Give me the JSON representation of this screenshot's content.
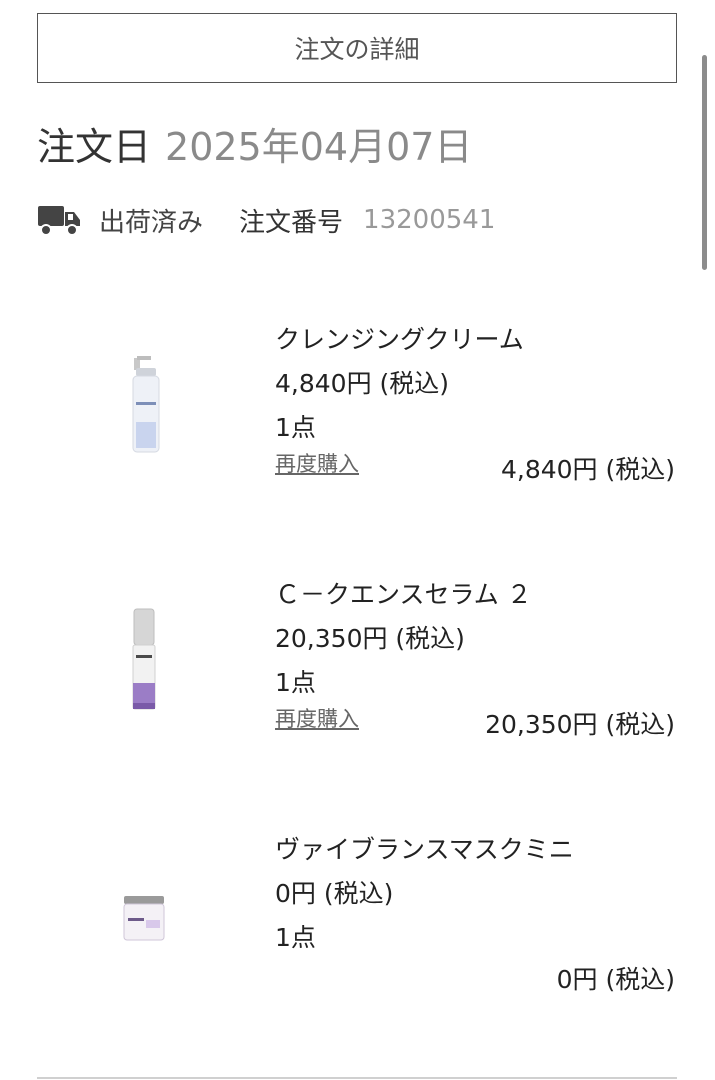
{
  "header": {
    "detail_button_label": "注文の詳細"
  },
  "order": {
    "date_label": "注文日",
    "date_value": "2025年04月07日",
    "status": "出荷済み",
    "order_number_label": "注文番号",
    "order_number": "13200541"
  },
  "items": [
    {
      "name": "クレンジングクリーム",
      "price": "4,840円 (税込)",
      "quantity": "1点",
      "rebuy_label": "再度購入",
      "total": "4,840円 (税込)"
    },
    {
      "name": "Ｃ－クエンスセラム ２",
      "price": "20,350円 (税込)",
      "quantity": "1点",
      "rebuy_label": "再度購入",
      "total": "20,350円 (税込)"
    },
    {
      "name": "ヴァイブランスマスクミニ",
      "price": "0円 (税込)",
      "quantity": "1点",
      "total": "0円 (税込)"
    }
  ],
  "icons": {
    "status_icon": "truck-icon"
  },
  "colors": {
    "border": "#555555",
    "muted_text": "#8a8a8a",
    "link": "#666666"
  }
}
